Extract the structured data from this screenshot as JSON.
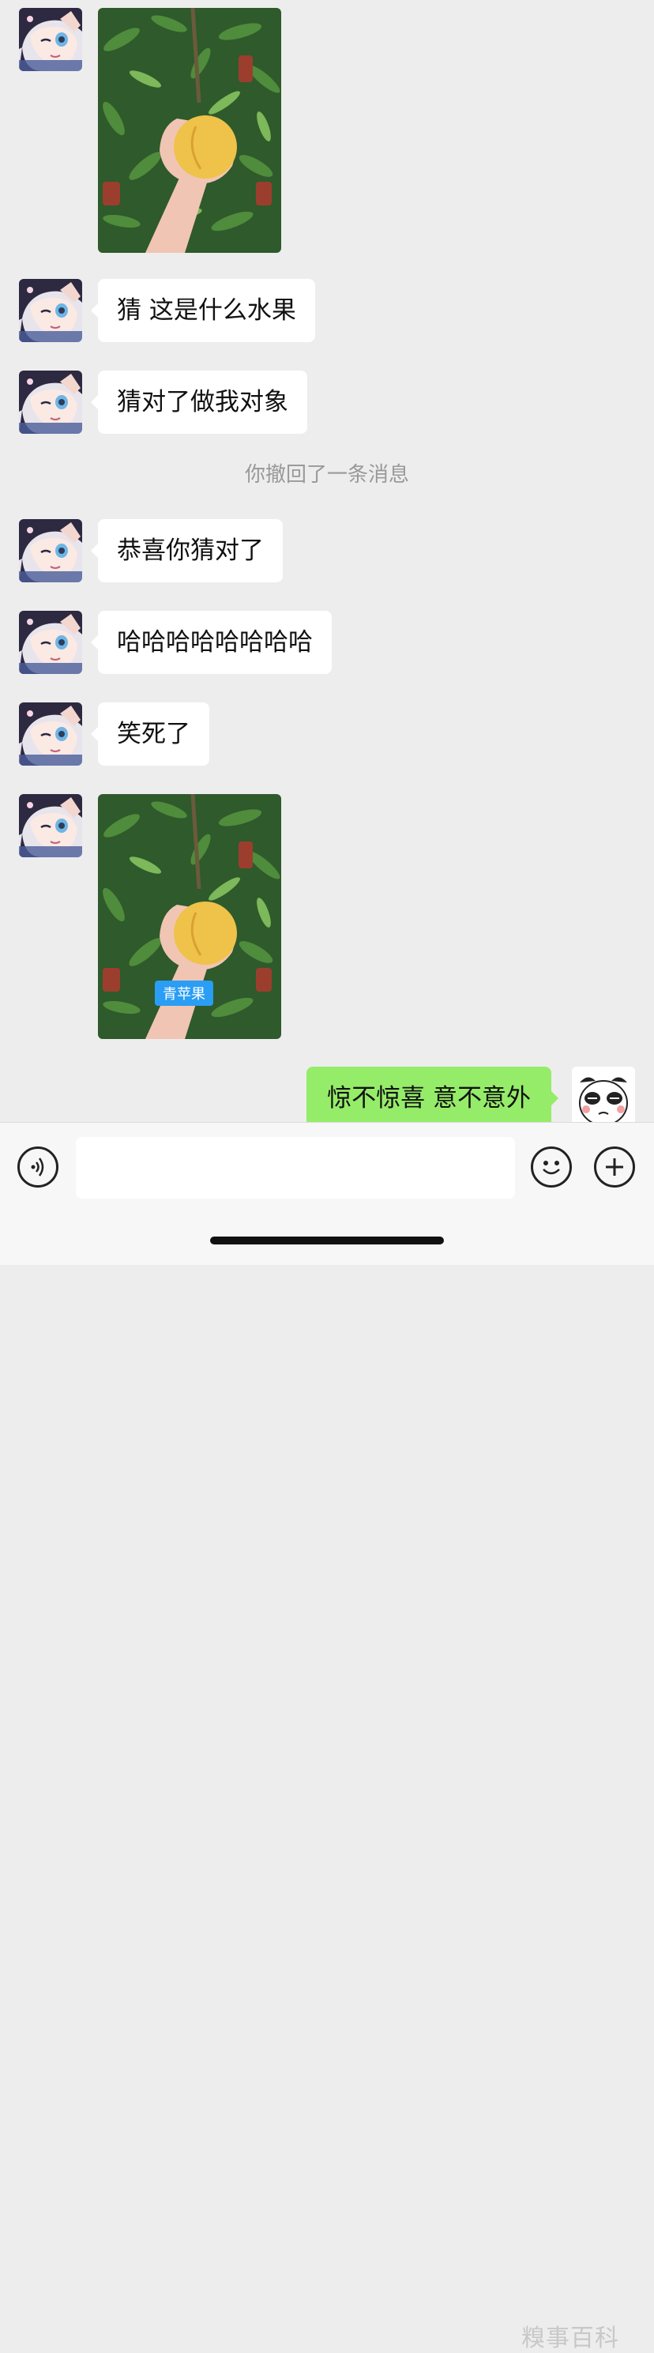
{
  "messages": [
    {
      "type": "image",
      "caption": ""
    },
    {
      "type": "text",
      "text": "猜 这是什么水果"
    },
    {
      "type": "text",
      "text": "猜对了做我对象"
    },
    {
      "type": "system",
      "text": "你撤回了一条消息"
    },
    {
      "type": "text",
      "text": "恭喜你猜对了"
    },
    {
      "type": "text",
      "text": "哈哈哈哈哈哈哈哈"
    },
    {
      "type": "text",
      "text": "笑死了"
    },
    {
      "type": "image",
      "caption": "青苹果"
    },
    {
      "type": "text",
      "direction": "outgoing",
      "text": "惊不惊喜  意不意外"
    }
  ],
  "input": {
    "value": "",
    "placeholder": ""
  },
  "icons": {
    "voice": "voice-icon",
    "emoji": "emoji-icon",
    "plus": "plus-icon"
  },
  "watermark": "糗事百科",
  "colors": {
    "outgoing_bubble": "#95ec69",
    "incoming_bubble": "#ffffff",
    "background": "#ededed",
    "tag": "#2a9df4"
  }
}
